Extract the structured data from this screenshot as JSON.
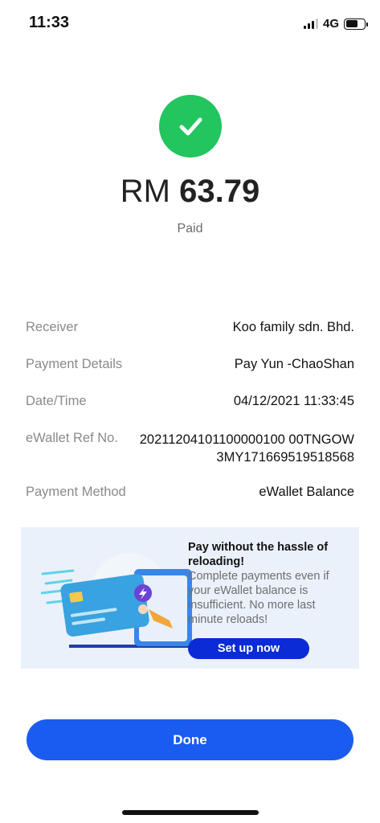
{
  "status_bar": {
    "time": "11:33",
    "network": "4G",
    "signal_bars_active": 3,
    "battery_level": 0.66
  },
  "payment": {
    "currency": "RM",
    "amount": "63.79",
    "status": "Paid",
    "status_icon": "check-icon",
    "status_color": "#22c55e"
  },
  "details": [
    {
      "label": "Receiver",
      "value": "Koo family sdn. Bhd."
    },
    {
      "label": "Payment Details",
      "value": "Pay Yun -ChaoShan"
    },
    {
      "label": "Date/Time",
      "value": "04/12/2021 11:33:45"
    },
    {
      "label": "eWallet Ref No.",
      "value": "20211204101100000100 00TNGOW3MY171669519518568"
    },
    {
      "label": "Payment Method",
      "value": "eWallet Balance"
    }
  ],
  "promo": {
    "title": "Pay without the hassle of reloading!",
    "body": "Complete payments even if your eWallet balance is insufficient. No more last minute reloads!",
    "button_label": "Set up now",
    "background_color": "#eaf1fb",
    "button_color": "#0a2bd6"
  },
  "done_label": "Done",
  "accent_color": "#1a5cf0"
}
